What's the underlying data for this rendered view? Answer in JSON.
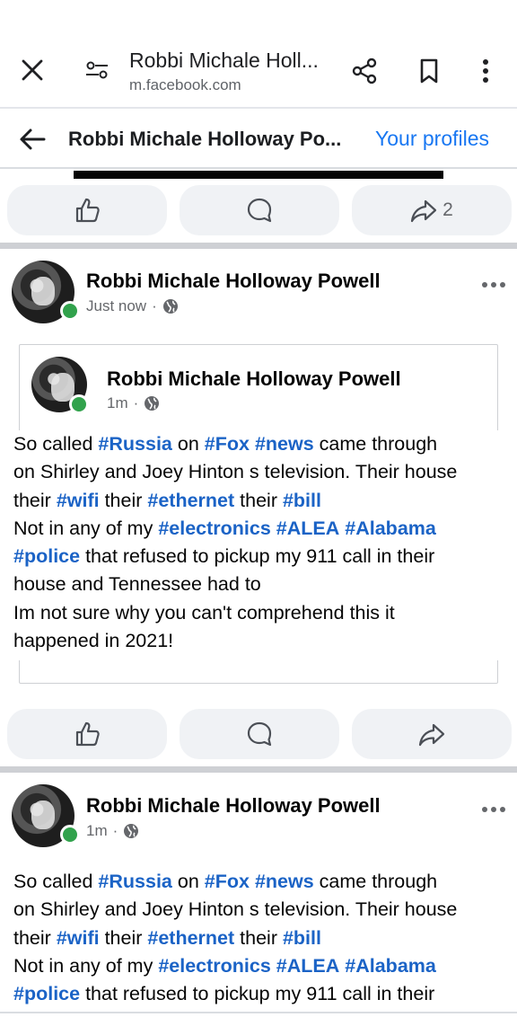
{
  "browser": {
    "title": "Robbi Michale Holl...",
    "url": "m.facebook.com"
  },
  "header": {
    "title": "Robbi Michale Holloway Po...",
    "your_profiles": "Your profiles"
  },
  "top_actions": {
    "share_count": "2"
  },
  "posts": [
    {
      "author": "Robbi Michale Holloway Powell",
      "time": "Just now",
      "dot": "·",
      "shared": {
        "author": "Robbi Michale Holloway Powell",
        "time": "1m",
        "dot": "·",
        "lines": [
          [
            {
              "t": "So called "
            },
            {
              "h": "#Russia"
            },
            {
              "t": " on "
            },
            {
              "h": "#Fox"
            },
            {
              "t": " "
            },
            {
              "h": "#news"
            },
            {
              "t": " came through"
            }
          ],
          [
            {
              "t": "on Shirley and Joey Hinton s television. Their house"
            }
          ],
          [
            {
              "t": "their "
            },
            {
              "h": "#wifi"
            },
            {
              "t": " their "
            },
            {
              "h": "#ethernet"
            },
            {
              "t": " their "
            },
            {
              "h": "#bill"
            }
          ],
          [
            {
              "t": "Not in any of my "
            },
            {
              "h": "#electronics"
            },
            {
              "t": " "
            },
            {
              "h": "#ALEA"
            },
            {
              "t": " "
            },
            {
              "h": "#Alabama"
            }
          ],
          [
            {
              "h": "#police"
            },
            {
              "t": " that refused to pickup my 911 call in their"
            }
          ],
          [
            {
              "t": "house and Tennessee had to"
            }
          ],
          [
            {
              "t": "Im not sure why you can't comprehend this it"
            }
          ],
          [
            {
              "t": "happened in 2021!"
            }
          ]
        ]
      }
    },
    {
      "author": "Robbi Michale Holloway Powell",
      "time": "1m",
      "dot": "·",
      "lines": [
        [
          {
            "t": "So called "
          },
          {
            "h": "#Russia"
          },
          {
            "t": " on "
          },
          {
            "h": "#Fox"
          },
          {
            "t": " "
          },
          {
            "h": "#news"
          },
          {
            "t": " came through"
          }
        ],
        [
          {
            "t": "on Shirley and Joey Hinton s television. Their house"
          }
        ],
        [
          {
            "t": "their "
          },
          {
            "h": "#wifi"
          },
          {
            "t": " their "
          },
          {
            "h": "#ethernet"
          },
          {
            "t": " their "
          },
          {
            "h": "#bill"
          }
        ],
        [
          {
            "t": "Not in any of my "
          },
          {
            "h": "#electronics"
          },
          {
            "t": " "
          },
          {
            "h": "#ALEA"
          },
          {
            "t": " "
          },
          {
            "h": "#Alabama"
          }
        ],
        [
          {
            "h": "#police"
          },
          {
            "t": " that refused to pickup my 911 call in their"
          }
        ]
      ]
    }
  ],
  "colors": {
    "link": "#1877f2",
    "hashtag": "#1b63c6",
    "online": "#31a24c",
    "pill": "#f0f2f5"
  },
  "icons": [
    "close-icon",
    "tune-icon",
    "share-icon",
    "bookmark-icon",
    "more-vert-icon",
    "back-arrow-icon",
    "like-icon",
    "comment-icon",
    "share-arrow-icon",
    "globe-icon",
    "more-horizontal-icon"
  ]
}
